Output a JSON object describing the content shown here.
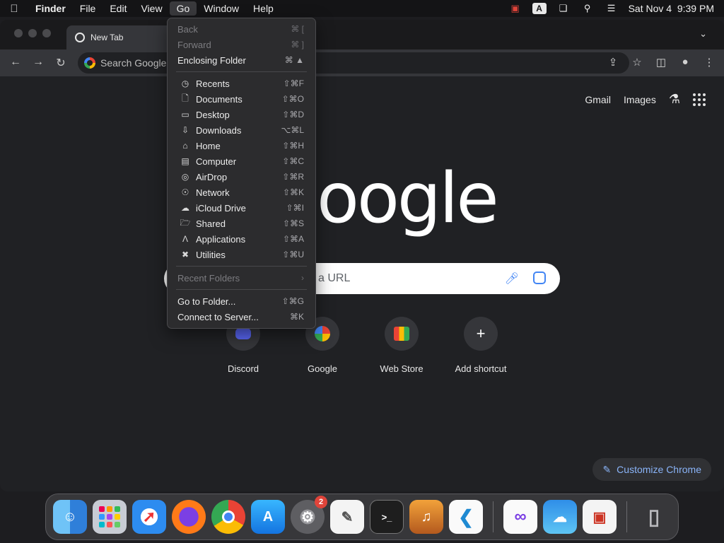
{
  "menubar": {
    "apple_icon": "apple-icon",
    "items": [
      "Finder",
      "File",
      "Edit",
      "View",
      "Go",
      "Window",
      "Help"
    ],
    "datetime": "Sat Nov 4  9:39 PM",
    "keyboard_input": "A"
  },
  "chrome": {
    "tab_title": "New Tab",
    "omnibox_placeholder": "Search Google",
    "top_links": {
      "gmail": "Gmail",
      "images": "Images"
    },
    "search_placeholder_visible": "a URL",
    "logo_text": "oogle",
    "shortcuts": [
      {
        "label": "Discord",
        "icon": "discord-icon"
      },
      {
        "label": "Google",
        "icon": "google-icon"
      },
      {
        "label": "Web Store",
        "icon": "webstore-icon"
      },
      {
        "label": "Add shortcut",
        "icon": "plus-icon"
      }
    ],
    "customize_label": "Customize Chrome",
    "colors": {
      "accent": "#8ab4f8",
      "page_bg": "#202124"
    }
  },
  "go_menu": {
    "back": {
      "label": "Back",
      "shortcut": "⌘ ["
    },
    "forward": {
      "label": "Forward",
      "shortcut": "⌘ ]"
    },
    "enclosing": {
      "label": "Enclosing Folder",
      "shortcut": "⌘ ▲"
    },
    "places": [
      {
        "label": "Recents",
        "shortcut": "⇧⌘F",
        "icon": "clock-icon"
      },
      {
        "label": "Documents",
        "shortcut": "⇧⌘O",
        "icon": "document-icon"
      },
      {
        "label": "Desktop",
        "shortcut": "⇧⌘D",
        "icon": "desktop-icon"
      },
      {
        "label": "Downloads",
        "shortcut": "⌥⌘L",
        "icon": "download-icon"
      },
      {
        "label": "Home",
        "shortcut": "⇧⌘H",
        "icon": "home-icon"
      },
      {
        "label": "Computer",
        "shortcut": "⇧⌘C",
        "icon": "computer-icon"
      },
      {
        "label": "AirDrop",
        "shortcut": "⇧⌘R",
        "icon": "airdrop-icon"
      },
      {
        "label": "Network",
        "shortcut": "⇧⌘K",
        "icon": "network-icon"
      },
      {
        "label": "iCloud Drive",
        "shortcut": "⇧⌘I",
        "icon": "cloud-icon"
      },
      {
        "label": "Shared",
        "shortcut": "⇧⌘S",
        "icon": "shared-folder-icon"
      },
      {
        "label": "Applications",
        "shortcut": "⇧⌘A",
        "icon": "applications-icon"
      },
      {
        "label": "Utilities",
        "shortcut": "⇧⌘U",
        "icon": "utilities-icon"
      }
    ],
    "recent_folders": "Recent Folders",
    "go_to_folder": {
      "label": "Go to Folder...",
      "shortcut": "⇧⌘G"
    },
    "connect_server": {
      "label": "Connect to Server...",
      "shortcut": "⌘K"
    }
  },
  "dock": {
    "apps": [
      "finder-icon",
      "launchpad-icon",
      "safari-icon",
      "firefox-icon",
      "chrome-icon",
      "app-store-icon",
      "system-settings-icon",
      "textedit-icon",
      "terminal-icon",
      "garageband-icon",
      "vscode-icon"
    ],
    "system_settings_badge": "2",
    "recent_apps": [
      "visual-studio-icon",
      "weather-icon",
      "parallels-icon"
    ],
    "trash": "trash-icon"
  }
}
